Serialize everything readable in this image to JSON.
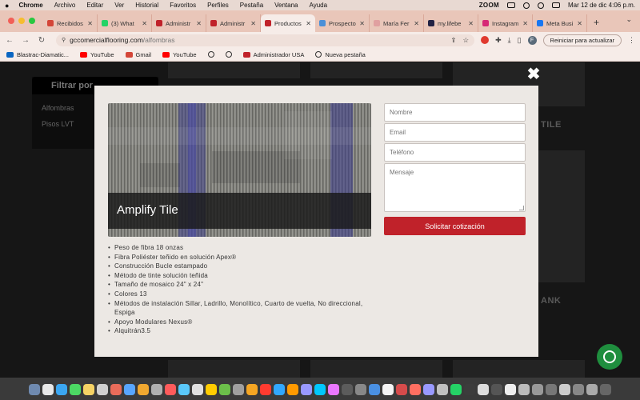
{
  "menubar": {
    "app_name": "Chrome",
    "items": [
      "Archivo",
      "Editar",
      "Ver",
      "Historial",
      "Favoritos",
      "Perfiles",
      "Pestaña",
      "Ventana",
      "Ayuda"
    ],
    "zoom_label": "ZOOM",
    "datetime": "Mar 12 de dic 4:06 p.m."
  },
  "tabs": [
    {
      "label": "Recibidos",
      "color": "#d44638"
    },
    {
      "label": "(3) What",
      "color": "#25d366"
    },
    {
      "label": "Administr",
      "color": "#c0222a"
    },
    {
      "label": "Administr",
      "color": "#c0222a"
    },
    {
      "label": "Productos",
      "color": "#c0222a",
      "active": true
    },
    {
      "label": "Prospecto",
      "color": "#4a8fd8"
    },
    {
      "label": "María Fer",
      "color": "#e0a0a0"
    },
    {
      "label": "my.lifebe",
      "color": "#222244"
    },
    {
      "label": "Instagram",
      "color": "#d62976"
    },
    {
      "label": "Meta Busi",
      "color": "#1877f2"
    }
  ],
  "address": {
    "host": "gccomercialflooring.com",
    "path": "/alfombras",
    "update_label": "Reiniciar para actualizar",
    "profile_initial": "F"
  },
  "bookmarks": [
    {
      "label": "Blastrac-Diamatic...",
      "color": "#0a66c2"
    },
    {
      "label": "YouTube",
      "color": "#ff0000"
    },
    {
      "label": "Gmail",
      "color": "#d44638"
    },
    {
      "label": "YouTube",
      "color": "#ff0000"
    },
    {
      "label": "",
      "globe": true
    },
    {
      "label": "",
      "globe": true
    },
    {
      "label": "Administrador USA",
      "color": "#c0222a"
    },
    {
      "label": "Nueva pestaña",
      "globe": true
    }
  ],
  "background": {
    "filter_title": "Filtrar por",
    "links": [
      "Alfombras",
      "Pisos LVT"
    ],
    "right_text_1": "TILE",
    "right_text_2": "ANK"
  },
  "modal": {
    "product_name": "Amplify Tile",
    "specs": [
      "Peso de fibra 18 onzas",
      "Fibra Poliéster teñido en solución Apex®",
      "Construcción Bucle estampado",
      "Método de tinte solución teñida",
      "Tamaño de mosaico 24\" x 24\"",
      "Colores 13",
      "Métodos de instalación Sillar, Ladrillo, Monolítico, Cuarto de vuelta, No direccional, Espiga",
      "Apoyo Modulares Nexus®",
      "Alquitrán3.5"
    ],
    "form": {
      "name_placeholder": "Nombre",
      "email_placeholder": "Email",
      "phone_placeholder": "Teléfono",
      "message_placeholder": "Mensaje",
      "submit_label": "Solicitar cotización"
    },
    "close_label": "✖"
  },
  "colors": {
    "accent_red": "#c0222a",
    "tab_bar": "#e9c6b9",
    "modal_bg": "#ece8e4"
  }
}
